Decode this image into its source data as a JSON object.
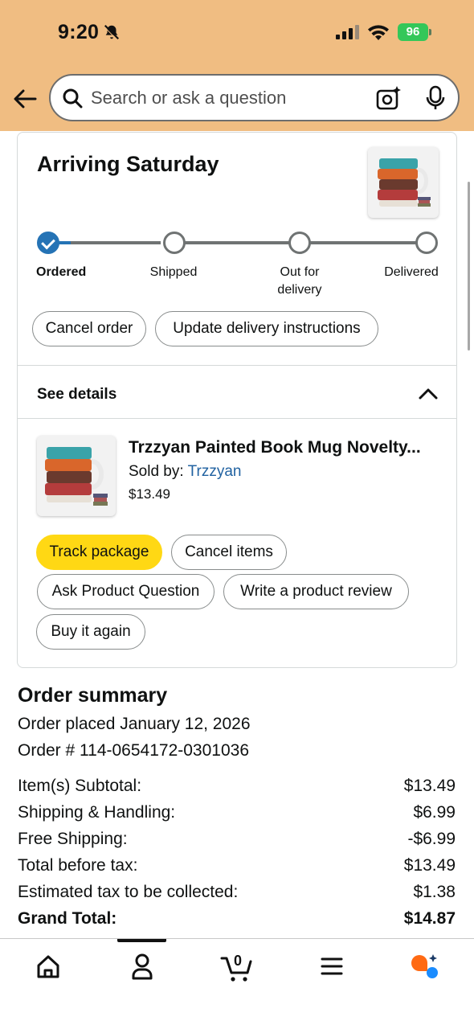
{
  "status_bar": {
    "time": "9:20",
    "battery": "96"
  },
  "header": {
    "search_placeholder": "Search or ask a question"
  },
  "order_card": {
    "title": "Arriving Saturday",
    "steps": [
      "Ordered",
      "Shipped",
      "Out for delivery",
      "Delivered"
    ],
    "current_step": 0,
    "actions": [
      "Cancel order",
      "Update delivery instructions"
    ],
    "see_details": "See details",
    "item": {
      "title": "Trzzyan Painted Book Mug Novelty...",
      "sold_by_label": "Sold by: ",
      "seller": "Trzzyan",
      "price": "$13.49"
    },
    "item_actions": [
      "Track package",
      "Cancel items",
      "Ask Product Question",
      "Write a product review",
      "Buy it again"
    ]
  },
  "summary": {
    "title": "Order summary",
    "placed": "Order placed January 12, 2026",
    "order_number": "Order # 114-0654172-0301036",
    "rows": [
      {
        "label": "Item(s) Subtotal:",
        "value": "$13.49"
      },
      {
        "label": "Shipping & Handling:",
        "value": "$6.99"
      },
      {
        "label": "Free Shipping:",
        "value": "-$6.99"
      },
      {
        "label": "Total before tax:",
        "value": "$13.49"
      },
      {
        "label": "Estimated tax to be collected:",
        "value": "$1.38"
      },
      {
        "label": "Grand Total:",
        "value": "$14.87"
      }
    ]
  },
  "bottom_nav": [
    {
      "icon": "home-icon"
    },
    {
      "icon": "account-icon"
    },
    {
      "icon": "cart-icon",
      "badge": "0"
    },
    {
      "icon": "menu-icon"
    },
    {
      "icon": "rufus-ai-icon"
    }
  ],
  "colors": {
    "header_bg": "#f0bd82",
    "progress_blue": "#2573b5",
    "button_yellow": "#ffd814",
    "link_blue": "#2162a1"
  }
}
